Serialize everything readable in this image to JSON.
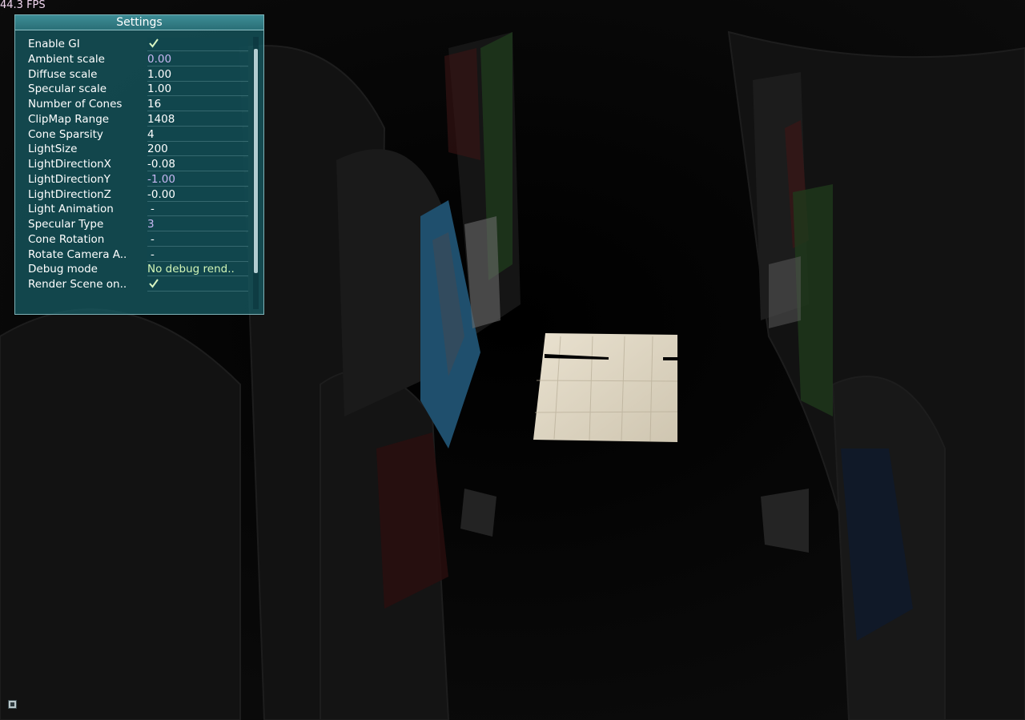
{
  "fps": {
    "text": "44.3 FPS"
  },
  "settings": {
    "title": "Settings",
    "items": [
      {
        "label": "Enable GI",
        "value": "",
        "kind": "check"
      },
      {
        "label": "Ambient scale",
        "value": "0.00",
        "kind": "purple"
      },
      {
        "label": "Diffuse scale",
        "value": "1.00",
        "kind": "white"
      },
      {
        "label": "Specular scale",
        "value": "1.00",
        "kind": "white"
      },
      {
        "label": "Number of Cones",
        "value": "16",
        "kind": "white"
      },
      {
        "label": "ClipMap Range",
        "value": "1408",
        "kind": "white"
      },
      {
        "label": "Cone Sparsity",
        "value": "4",
        "kind": "white"
      },
      {
        "label": "LightSize",
        "value": "200",
        "kind": "white"
      },
      {
        "label": "LightDirectionX",
        "value": "-0.08",
        "kind": "white"
      },
      {
        "label": "LightDirectionY",
        "value": "-1.00",
        "kind": "purple"
      },
      {
        "label": "LightDirectionZ",
        "value": "-0.00",
        "kind": "white"
      },
      {
        "label": "Light Animation",
        "value": "-",
        "kind": "dash"
      },
      {
        "label": "Specular Type",
        "value": "3",
        "kind": "purple"
      },
      {
        "label": "Cone Rotation",
        "value": "-",
        "kind": "dash"
      },
      {
        "label": "Rotate Camera A..",
        "value": "-",
        "kind": "dash"
      },
      {
        "label": "Debug mode",
        "value": "No debug rend..",
        "kind": "green"
      },
      {
        "label": "Render Scene on..",
        "value": "",
        "kind": "check"
      }
    ]
  },
  "colors": {
    "panel_bg": "#165860",
    "label_text": "#ffffff",
    "value_purple": "#c7b8f2",
    "value_green": "#d2f5b6",
    "fps_text": "#f2d6f0",
    "checkmark": "#d8f5c2"
  },
  "icons": {
    "checkmark": "check-icon",
    "help": "help-icon"
  }
}
